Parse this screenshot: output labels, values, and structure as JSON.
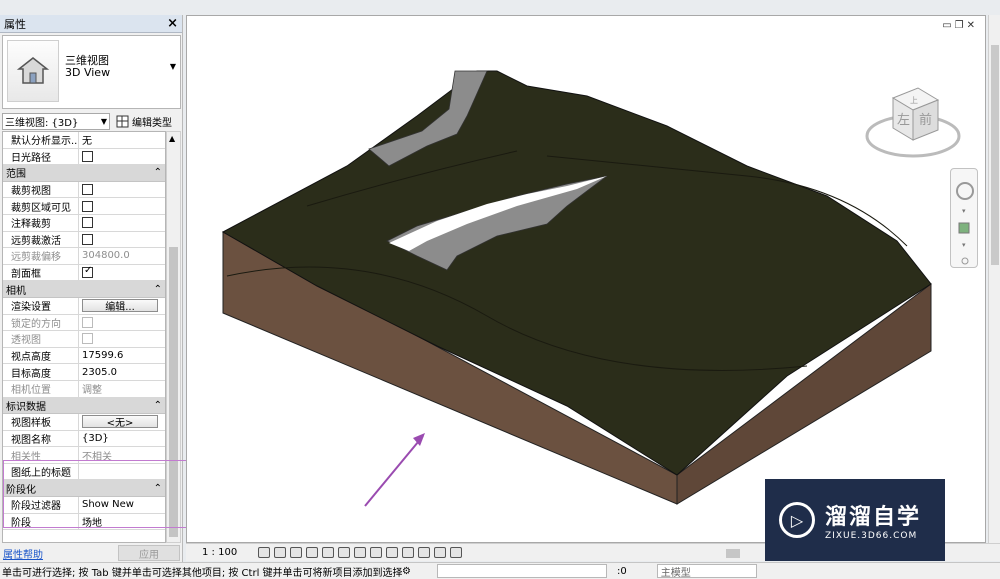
{
  "properties": {
    "title": "属性",
    "close": "×",
    "type_name_cn": "三维视图",
    "type_name_en": "3D View",
    "view_selector": "三维视图: {3D}",
    "edit_type": "编辑类型",
    "rows": [
      {
        "kind": "row",
        "key": "默认分析显示...",
        "value": "无"
      },
      {
        "kind": "row",
        "key": "日光路径",
        "check": false
      },
      {
        "kind": "group",
        "key": "范围"
      },
      {
        "kind": "row",
        "key": "裁剪视图",
        "check": false
      },
      {
        "kind": "row",
        "key": "裁剪区域可见",
        "check": false
      },
      {
        "kind": "row",
        "key": "注释裁剪",
        "check": false
      },
      {
        "kind": "row",
        "key": "远剪裁激活",
        "check": false
      },
      {
        "kind": "row",
        "key": "远剪裁偏移",
        "value": "304800.0",
        "disabled": true
      },
      {
        "kind": "row",
        "key": "剖面框",
        "check": true
      },
      {
        "kind": "group",
        "key": "相机"
      },
      {
        "kind": "row",
        "key": "渲染设置",
        "button": "编辑..."
      },
      {
        "kind": "row",
        "key": "锁定的方向",
        "check": false,
        "disabled": true
      },
      {
        "kind": "row",
        "key": "透视图",
        "check": false,
        "disabled": true
      },
      {
        "kind": "row",
        "key": "视点高度",
        "value": "17599.6"
      },
      {
        "kind": "row",
        "key": "目标高度",
        "value": "2305.0"
      },
      {
        "kind": "row",
        "key": "相机位置",
        "value": "调整",
        "disabled": true
      },
      {
        "kind": "group",
        "key": "标识数据"
      },
      {
        "kind": "row",
        "key": "视图样板",
        "button": "<无>"
      },
      {
        "kind": "row",
        "key": "视图名称",
        "value": "{3D}"
      },
      {
        "kind": "row",
        "key": "相关性",
        "value": "不相关",
        "disabled": true
      },
      {
        "kind": "row",
        "key": "图纸上的标题",
        "value": ""
      },
      {
        "kind": "group",
        "key": "阶段化"
      },
      {
        "kind": "row",
        "key": "阶段过滤器",
        "value": "Show New"
      },
      {
        "kind": "row",
        "key": "阶段",
        "value": "场地"
      }
    ],
    "help_link": "属性帮助",
    "apply": "应用"
  },
  "viewcube": {
    "left": "左",
    "front": "前",
    "top": "上"
  },
  "view_control_bar": {
    "scale": "1 : 100"
  },
  "status": {
    "message": "单击可进行选择; 按 Tab 键并单击可选择其他项目; 按 Ctrl 键并单击可将新项目添加到选择集",
    "zero": ":0",
    "model": "主模型"
  },
  "watermark": {
    "cn": "溜溜自学",
    "en": "ZIXUE.3D66.COM"
  },
  "colors": {
    "terrain_top": "#2b2d1a",
    "terrain_side": "#6b5140",
    "pad": "#8c8c8c",
    "arrow": "#9a4bb0"
  }
}
